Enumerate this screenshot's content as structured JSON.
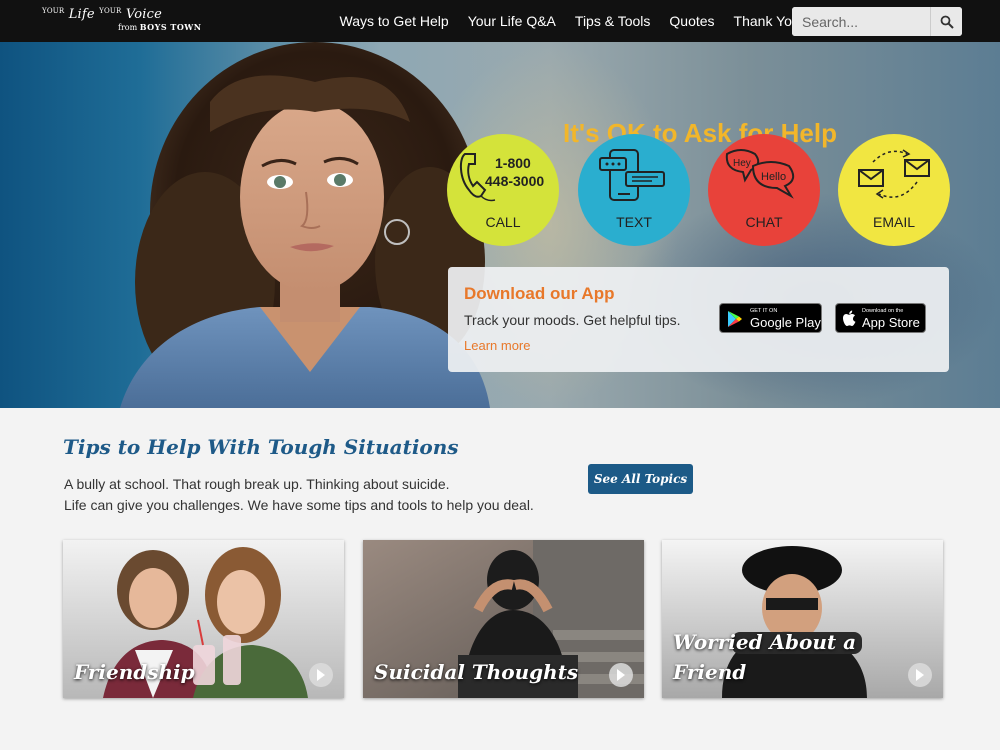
{
  "logo": {
    "line1_a": "YOUR",
    "line1_b": "Life",
    "line1_c": "YOUR",
    "line1_d": "Voice",
    "line2_from": "from",
    "line2_org": "BOYS TOWN"
  },
  "nav": {
    "items": [
      {
        "label": "Ways to Get Help"
      },
      {
        "label": "Your Life Q&A"
      },
      {
        "label": "Tips & Tools"
      },
      {
        "label": "Quotes"
      },
      {
        "label": "Thank Yous"
      }
    ],
    "search_placeholder": "Search..."
  },
  "hero": {
    "title": "It's OK to Ask for Help",
    "contacts": {
      "call": {
        "label": "CALL",
        "phone_line1": "1-800",
        "phone_line2": "448-3000",
        "icon": "phone-icon",
        "color": "#d4e33a"
      },
      "text": {
        "label": "TEXT",
        "icon": "smartphone-chat-icon",
        "color": "#2aaecf"
      },
      "chat": {
        "label": "CHAT",
        "bubble1": "Hey",
        "bubble2": "Hello",
        "icon": "chat-bubbles-icon",
        "color": "#e8423a"
      },
      "email": {
        "label": "EMAIL",
        "icon": "envelopes-icon",
        "color": "#f1e641"
      }
    },
    "app": {
      "title": "Download our App",
      "description": "Track your moods. Get helpful tips.",
      "learn_more": "Learn more",
      "google_play": {
        "small": "GET IT ON",
        "big": "Google Play"
      },
      "app_store": {
        "small": "Download on the",
        "big": "App Store"
      }
    }
  },
  "tips": {
    "title": "Tips to Help With Tough Situations",
    "line1": "A bully at school. That rough break up. Thinking about suicide.",
    "line2": "Life can give you challenges. We have some tips and tools to help you deal.",
    "see_all": "See All Topics",
    "cards": [
      {
        "line1": "Friendship",
        "line2": ""
      },
      {
        "line1": "Suicidal Thoughts",
        "line2": ""
      },
      {
        "line1": "Worried About a",
        "line2": "Friend"
      }
    ]
  },
  "colors": {
    "accent_orange": "#e8782a",
    "brand_blue": "#1c5a87",
    "title_gold": "#f2b62a"
  }
}
